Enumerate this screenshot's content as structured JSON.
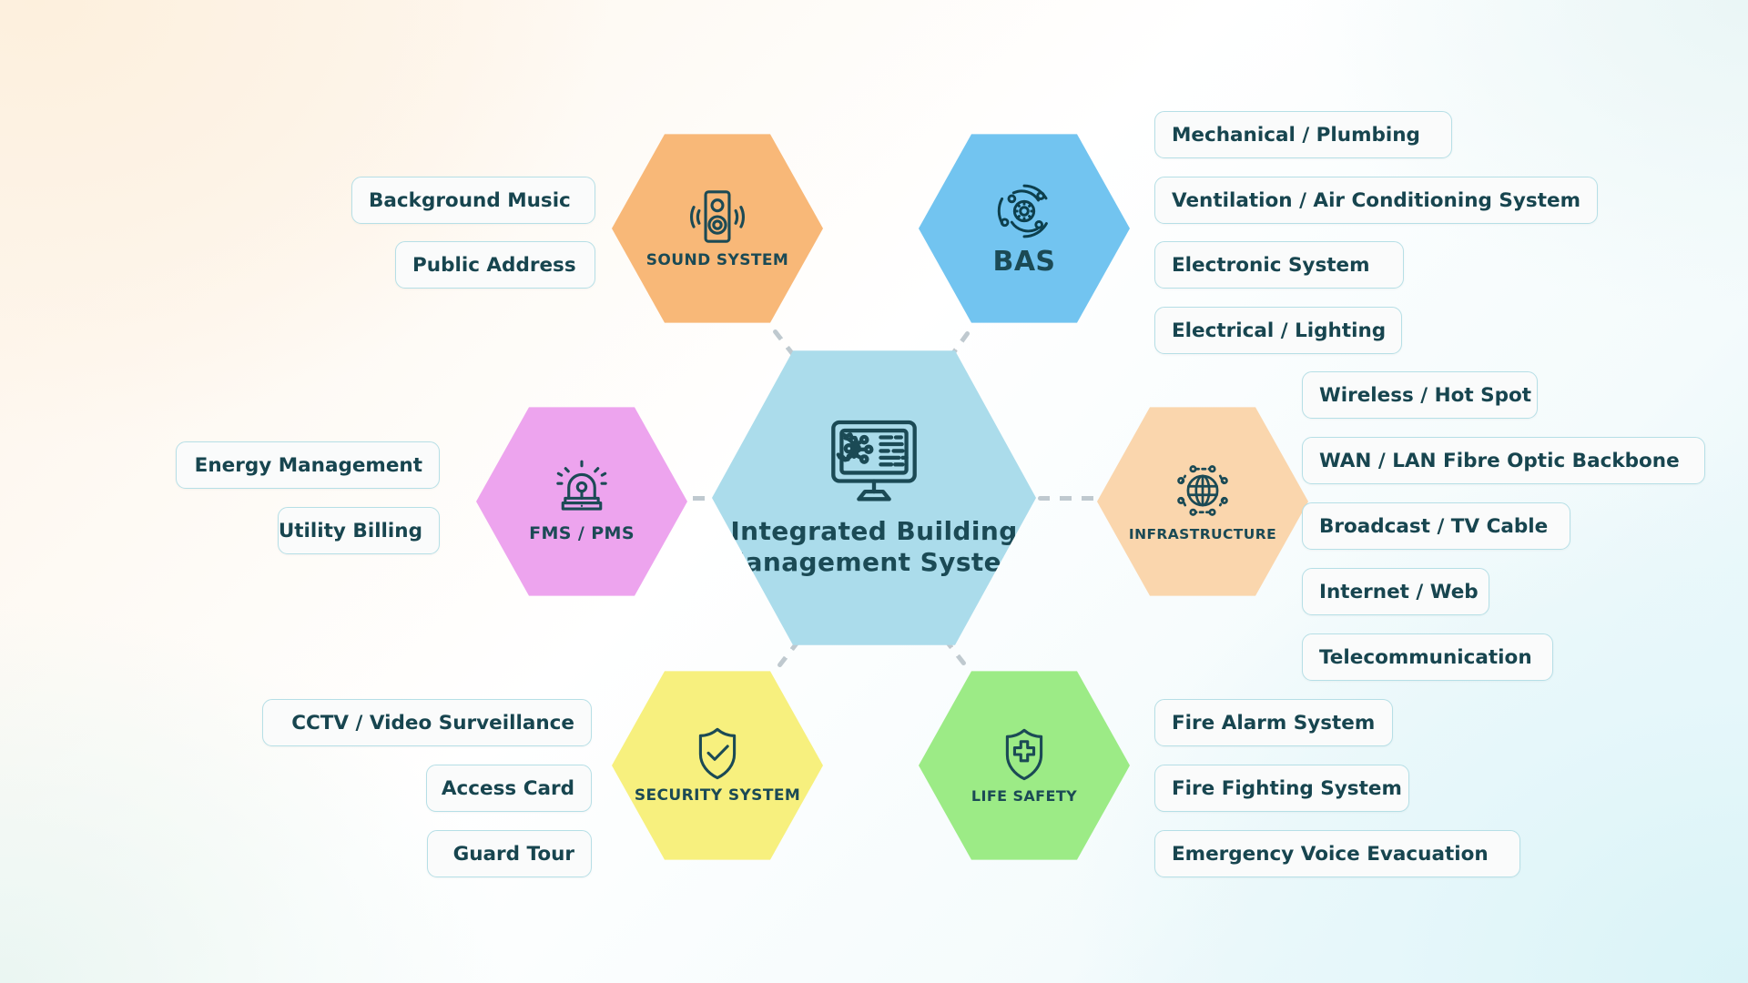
{
  "diagram": {
    "center": {
      "title": "Integrated Building Management System",
      "icon": "monitor-gear-network-icon",
      "color": "#abdceb"
    },
    "nodes": [
      {
        "key": "sound-system",
        "label": "SOUND SYSTEM",
        "icon": "speaker-icon",
        "color": "#f8b878",
        "items": [
          "Background Music",
          "Public Address"
        ]
      },
      {
        "key": "bas",
        "label": "BAS",
        "icon": "gear-orbit-icon",
        "color": "#72c4f0",
        "items": [
          "Mechanical / Plumbing",
          "Ventilation / Air Conditioning System",
          "Electronic System",
          "Electrical / Lighting"
        ]
      },
      {
        "key": "infrastructure",
        "label": "INFRASTRUCTURE",
        "icon": "globe-network-icon",
        "color": "#fad6ad",
        "items": [
          "Wireless / Hot Spot",
          "WAN / LAN Fibre Optic Backbone",
          "Broadcast / TV Cable",
          "Internet / Web",
          "Telecommunication"
        ]
      },
      {
        "key": "life-safety",
        "label": "LIFE SAFETY",
        "icon": "shield-cross-icon",
        "color": "#9ceb86",
        "items": [
          "Fire Alarm System",
          "Fire Fighting System",
          "Emergency Voice Evacuation"
        ]
      },
      {
        "key": "security-system",
        "label": "SECURITY SYSTEM",
        "icon": "shield-check-icon",
        "color": "#f7f07e",
        "items": [
          "CCTV / Video Surveillance",
          "Access Card",
          "Guard Tour"
        ]
      },
      {
        "key": "fms-pms",
        "label": "FMS / PMS",
        "icon": "alarm-beacon-icon",
        "color": "#eda4ee",
        "items": [
          "Energy Management",
          "Utility Billing"
        ]
      }
    ],
    "style": {
      "text_color": "#17454f",
      "pill_border": "#b6dfe6",
      "pill_fill": "#fafbfb",
      "connector": "#bfc9cf"
    }
  }
}
